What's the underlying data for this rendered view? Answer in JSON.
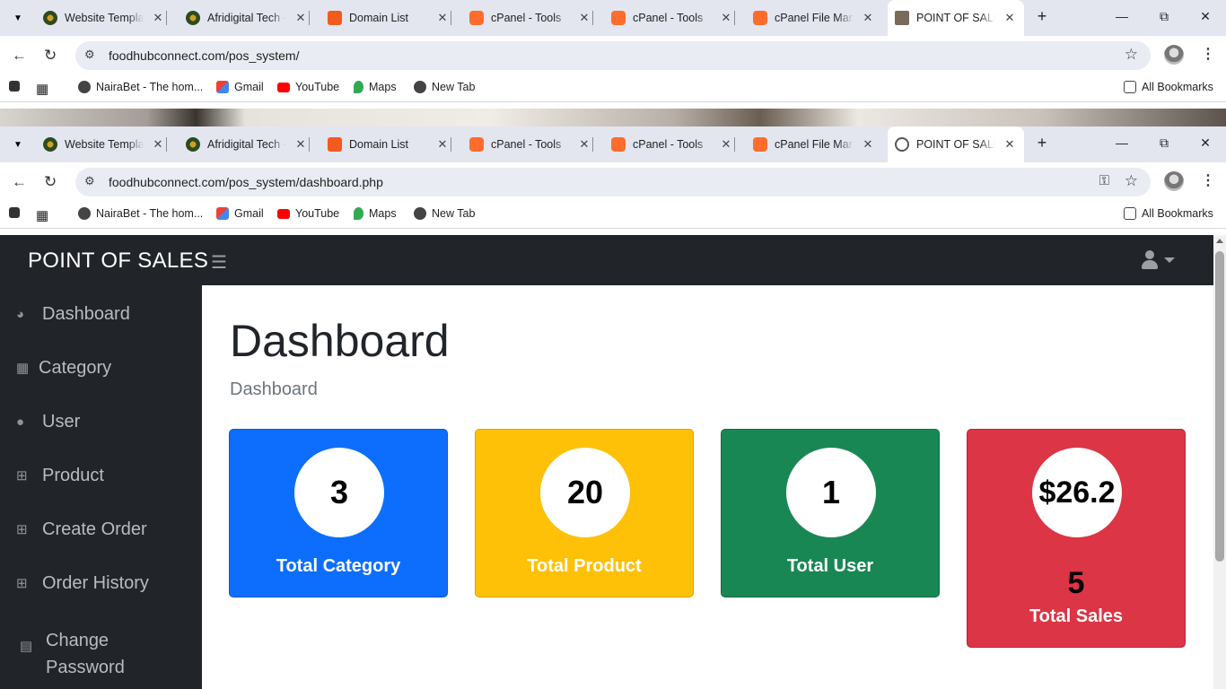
{
  "browser_back": {
    "tabs": [
      {
        "title": "Website Templat",
        "icon": "globe-dark-icon"
      },
      {
        "title": "Afridigital Tech -",
        "icon": "globe-dark-icon"
      },
      {
        "title": "Domain List",
        "icon": "namecheap-icon"
      },
      {
        "title": "cPanel - Tools",
        "icon": "cpanel-icon"
      },
      {
        "title": "cPanel - Tools",
        "icon": "cpanel-icon"
      },
      {
        "title": "cPanel File Mana",
        "icon": "cpanel-icon"
      },
      {
        "title": "POINT OF SALES",
        "icon": "photo-icon"
      }
    ],
    "url": "foodhubconnect.com/pos_system/"
  },
  "browser_front": {
    "tabs": [
      {
        "title": "Website Templat",
        "icon": "globe-dark-icon"
      },
      {
        "title": "Afridigital Tech -",
        "icon": "globe-dark-icon"
      },
      {
        "title": "Domain List",
        "icon": "namecheap-icon"
      },
      {
        "title": "cPanel - Tools",
        "icon": "cpanel-icon"
      },
      {
        "title": "cPanel - Tools",
        "icon": "cpanel-icon"
      },
      {
        "title": "cPanel File Mana",
        "icon": "cpanel-icon"
      },
      {
        "title": "POINT OF SALES",
        "icon": "globe-icon"
      }
    ],
    "url": "foodhubconnect.com/pos_system/dashboard.php"
  },
  "bookmarks": {
    "items": [
      "NairaBet - The hom...",
      "Gmail",
      "YouTube",
      "Maps",
      "New Tab"
    ],
    "all": "All Bookmarks"
  },
  "app": {
    "brand": "POINT OF SALES",
    "sidebar": [
      {
        "label": "Dashboard",
        "icon": "dashboard-icon"
      },
      {
        "label": "Category",
        "icon": "building-icon"
      },
      {
        "label": "User",
        "icon": "user-icon"
      },
      {
        "label": "Product",
        "icon": "plus-square-icon"
      },
      {
        "label": "Create Order",
        "icon": "plus-square-icon"
      },
      {
        "label": "Order History",
        "icon": "plus-square-icon"
      },
      {
        "label": "Change",
        "label2": "Password",
        "icon": "id-card-icon"
      }
    ],
    "title": "Dashboard",
    "breadcrumb": "Dashboard",
    "cards": [
      {
        "value": "3",
        "label": "Total Category",
        "color": "#0d6efd"
      },
      {
        "value": "20",
        "label": "Total Product",
        "color": "#ffc107"
      },
      {
        "value": "1",
        "label": "Total User",
        "color": "#198754"
      },
      {
        "value": "$26.2",
        "count": "5",
        "label": "Total Sales",
        "color": "#dc3545"
      }
    ]
  }
}
